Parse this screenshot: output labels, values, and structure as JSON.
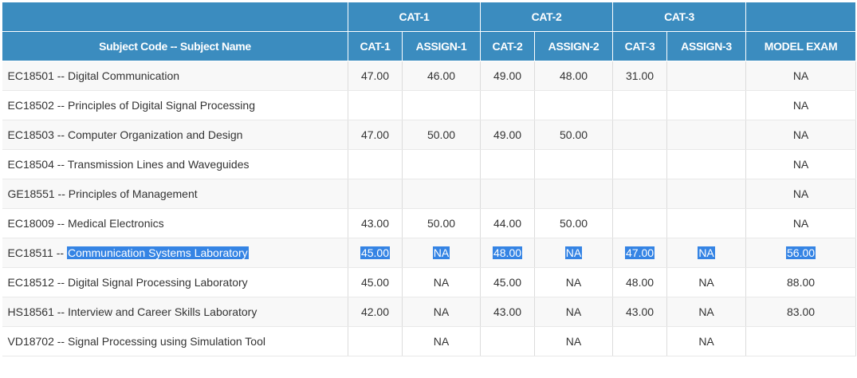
{
  "headers": {
    "group": [
      "",
      "CAT-1",
      "CAT-2",
      "CAT-3",
      ""
    ],
    "columns": [
      "Subject Code -- Subject Name",
      "CAT-1",
      "ASSIGN-1",
      "CAT-2",
      "ASSIGN-2",
      "CAT-3",
      "ASSIGN-3",
      "MODEL EXAM"
    ]
  },
  "rows": [
    {
      "code": "EC18501 -- ",
      "name": "Digital Communication",
      "cells": [
        "47.00",
        "46.00",
        "49.00",
        "48.00",
        "31.00",
        "",
        "NA"
      ]
    },
    {
      "code": "EC18502 -- ",
      "name": "Principles of Digital Signal Processing",
      "cells": [
        "",
        "",
        "",
        "",
        "",
        "",
        "NA"
      ]
    },
    {
      "code": "EC18503 -- ",
      "name": "Computer Organization and Design",
      "cells": [
        "47.00",
        "50.00",
        "49.00",
        "50.00",
        "",
        "",
        "NA"
      ]
    },
    {
      "code": "EC18504 -- ",
      "name": "Transmission Lines and Waveguides",
      "cells": [
        "",
        "",
        "",
        "",
        "",
        "",
        "NA"
      ]
    },
    {
      "code": "GE18551 -- ",
      "name": "Principles of Management",
      "cells": [
        "",
        "",
        "",
        "",
        "",
        "",
        "NA"
      ]
    },
    {
      "code": "EC18009 -- ",
      "name": "Medical Electronics",
      "cells": [
        "43.00",
        "50.00",
        "44.00",
        "50.00",
        "",
        "",
        "NA"
      ]
    },
    {
      "code": "EC18511 -- ",
      "name": "Communication Systems Laboratory",
      "cells": [
        "45.00",
        "NA",
        "48.00",
        "NA",
        "47.00",
        "NA",
        "56.00"
      ],
      "selected": true
    },
    {
      "code": "EC18512 -- ",
      "name": "Digital Signal Processing Laboratory",
      "cells": [
        "45.00",
        "NA",
        "45.00",
        "NA",
        "48.00",
        "NA",
        "88.00"
      ]
    },
    {
      "code": "HS18561 -- ",
      "name": "Interview and Career Skills Laboratory",
      "cells": [
        "42.00",
        "NA",
        "43.00",
        "NA",
        "43.00",
        "NA",
        "83.00"
      ]
    },
    {
      "code": "VD18702 -- ",
      "name": "Signal Processing using Simulation Tool",
      "cells": [
        "",
        "NA",
        "",
        "NA",
        "",
        "NA",
        ""
      ]
    }
  ],
  "colors": {
    "header": "#3b8cbf",
    "selection": "#3584e4"
  }
}
